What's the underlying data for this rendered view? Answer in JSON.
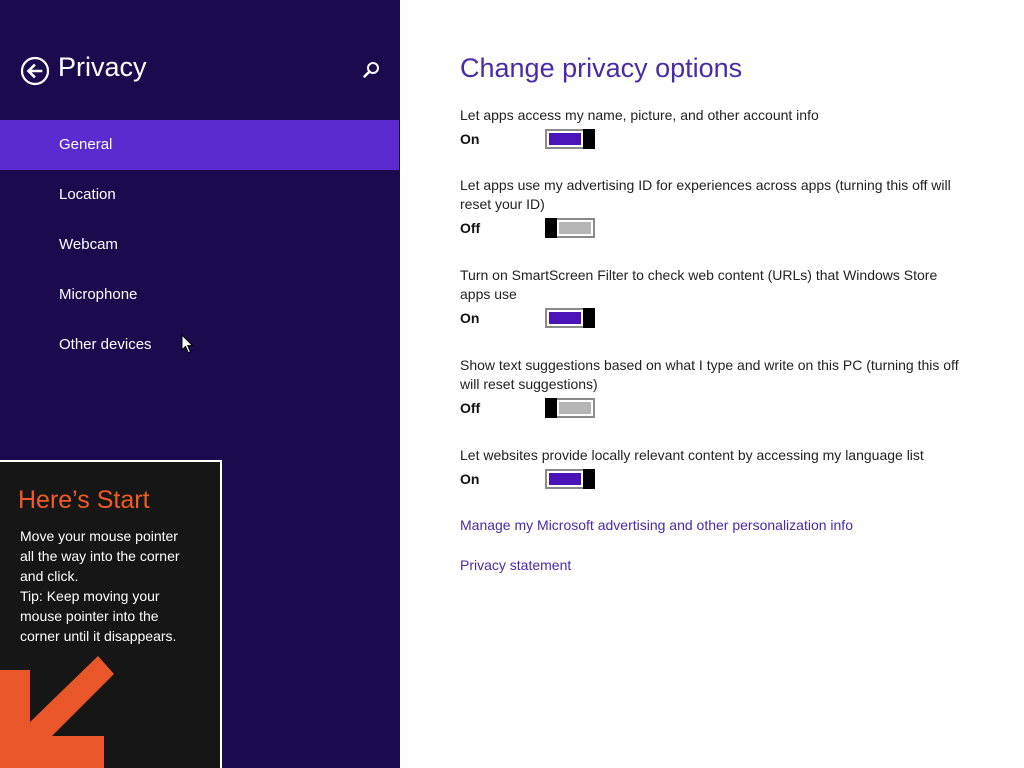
{
  "nav": {
    "title": "Privacy",
    "items": [
      {
        "label": "General",
        "selected": true
      },
      {
        "label": "Location",
        "selected": false
      },
      {
        "label": "Webcam",
        "selected": false
      },
      {
        "label": "Microphone",
        "selected": false
      },
      {
        "label": "Other devices",
        "selected": false
      }
    ]
  },
  "tip": {
    "title": "Here’s Start",
    "body": "Move your mouse pointer\nall the way into the corner\nand click.\nTip: Keep moving your\nmouse pointer into the\ncorner until it disappears."
  },
  "main": {
    "title": "Change privacy options",
    "settings": [
      {
        "description": "Let apps access my name, picture, and other account info",
        "state": "On"
      },
      {
        "description": "Let apps use my advertising ID for experiences across apps (turning this off will reset your ID)",
        "state": "Off"
      },
      {
        "description": "Turn on SmartScreen Filter to check web content (URLs) that Windows Store apps use",
        "state": "On"
      },
      {
        "description": "Show text suggestions based on what I type and write on this PC (turning this off will reset suggestions)",
        "state": "Off"
      },
      {
        "description": "Let websites provide locally relevant content by accessing my language list",
        "state": "On"
      }
    ],
    "links": {
      "manage_advertising": "Manage my Microsoft advertising and other personalization info",
      "privacy_statement": "Privacy statement"
    }
  },
  "icons": {
    "back": "back-arrow-icon",
    "search": "search-icon",
    "cursor": "mouse-pointer-icon",
    "tip_arrow": "diagonal-arrow-icon"
  },
  "colors": {
    "nav_background": "#1c0a4e",
    "nav_selected": "#5c2bd0",
    "accent": "#4b2aa5",
    "toggle_on": "#4a14b8",
    "toggle_off": "#b5b5b5",
    "tip_title": "#f15a24"
  }
}
